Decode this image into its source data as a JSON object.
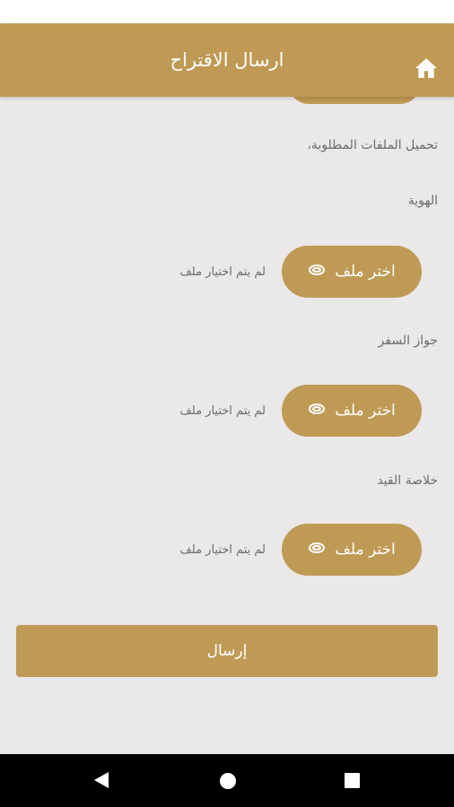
{
  "app": {
    "header": {
      "title": "ارسال الاقتراح",
      "home_icon": "home-icon"
    },
    "accent_color": "#bf9a54"
  },
  "upload": {
    "intro": "تحميل الملفات المطلوبة،",
    "fields": [
      {
        "label": "الهوية",
        "button_label": "اختر ملف",
        "status": "لم يتم اختيار ملف"
      },
      {
        "label": "جواز السفر",
        "button_label": "اختر ملف",
        "status": "لم يتم اختيار ملف"
      },
      {
        "label": "خلاصة القيد",
        "button_label": "اختر ملف",
        "status": "لم يتم اختيار ملف"
      }
    ]
  },
  "submit_label": "إرسال",
  "system_nav": {
    "back": "back-icon",
    "home": "home-circle-icon",
    "recents": "recents-icon"
  }
}
